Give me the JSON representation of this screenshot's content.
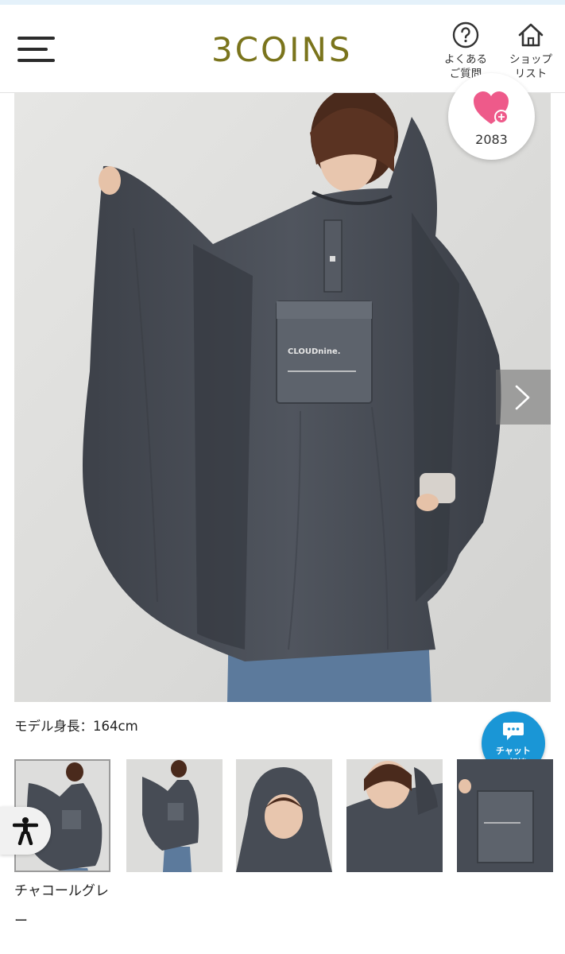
{
  "header": {
    "logo": "3COINS",
    "faq_label": "よくある\nご質問",
    "shop_label": "ショップ\nリスト",
    "menu_icon": "hamburger-menu-icon",
    "faq_icon": "question-circle-icon",
    "shop_icon": "house-icon"
  },
  "product": {
    "favorite_count": "2083",
    "favorite_icon": "heart-plus-icon",
    "next_icon": "chevron-right-icon",
    "model_height": "モデル身長：164cm",
    "color_name": "チャコールグレー",
    "pocket_text": "CLOUDnine.",
    "thumbnail_count": 5,
    "selected_thumbnail": 1
  },
  "chat": {
    "label": "チャット\nで相談",
    "icon": "chat-bubble-icon"
  },
  "accessibility": {
    "icon": "accessibility-person-icon"
  },
  "colors": {
    "brand": "#7a741c",
    "chat_blue": "#1a96d6",
    "heart_pink": "#ee5a8a",
    "poncho": "#4a4f58"
  }
}
